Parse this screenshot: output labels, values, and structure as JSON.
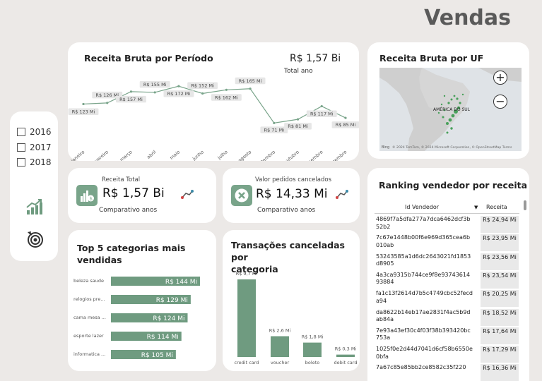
{
  "page_title": "Vendas",
  "filters": {
    "years": [
      "2016",
      "2017",
      "2018"
    ]
  },
  "period_card": {
    "title": "Receita Bruta por Período",
    "total_value": "R$ 1,57 Bi",
    "total_label": "Total ano"
  },
  "uf_card": {
    "title": "Receita Bruta por UF",
    "map_label": "AMÉRICA DO SUL",
    "attribution": "© 2024 TomTom, © 2024 Microsoft Corporation, © OpenStreetMap  Terms",
    "zoom_in": "+",
    "zoom_out": "−",
    "bing_label": "Bing"
  },
  "kpi_revenue": {
    "label": "Receita Total",
    "value": "R$ 1,57 Bi",
    "sub": "Comparativo anos"
  },
  "kpi_cancel": {
    "label": "Valor pedidos cancelados",
    "value": "R$ 14,33 Mi",
    "sub": "Comparativo anos"
  },
  "top5_card": {
    "title_line1": "Top 5 categorias mais",
    "title_line2": "vendidas"
  },
  "cancel_card": {
    "title_line1": "Transações canceladas por",
    "title_line2": "categoria"
  },
  "ranking_card": {
    "title": "Ranking vendedor por receita",
    "col_id": "Id Vendedor",
    "col_revenue": "Receita",
    "rows": [
      {
        "id": "4869f7a5dfa277a7dca6462dcf3b52b2",
        "revenue": "R$ 24,94 Mi"
      },
      {
        "id": "7c67e1448b00f6e969d365cea6b010ab",
        "revenue": "R$ 23,95 Mi"
      },
      {
        "id": "53243585a1d6dc2643021fd1853d8905",
        "revenue": "R$ 23,56 Mi"
      },
      {
        "id": "4a3ca9315b744ce9f8e9374361493884",
        "revenue": "R$ 23,54 Mi"
      },
      {
        "id": "fa1c13f2614d7b5c4749cbc52fecda94",
        "revenue": "R$ 20,25 Mi"
      },
      {
        "id": "da8622b14eb17ae2831f4ac5b9dab84a",
        "revenue": "R$ 18,52 Mi"
      },
      {
        "id": "7e93a43ef30c4f03f38b393420bc753a",
        "revenue": "R$ 17,64 Mi"
      },
      {
        "id": "1025f0e2d44d7041d6cf58b6550e0bfa",
        "revenue": "R$ 17,29 Mi"
      },
      {
        "id": "7a67c85e85bb2ce8582c35f220",
        "revenue": "R$ 16,36 Mi"
      }
    ]
  },
  "chart_data": [
    {
      "type": "line",
      "title": "Receita Bruta por Período",
      "categories": [
        "janeiro",
        "fevereiro",
        "março",
        "abril",
        "maio",
        "junho",
        "julho",
        "agosto",
        "setembro",
        "outubro",
        "novembro",
        "dezembro"
      ],
      "values": [
        123,
        126,
        157,
        155,
        172,
        152,
        162,
        165,
        71,
        81,
        117,
        85
      ],
      "data_labels": [
        "R$ 123 Mi",
        "R$ 126 Mi",
        "R$ 157 Mi",
        "R$ 155 Mi",
        "R$ 172 Mi",
        "R$ 152 Mi",
        "R$ 162 Mi",
        "R$ 165 Mi",
        "R$ 71 Mi",
        "R$ 81 Mi",
        "R$ 117 Mi",
        "R$ 85 Mi"
      ],
      "color": "#79a48a"
    },
    {
      "type": "bar",
      "orientation": "horizontal",
      "title": "Top 5 categorias mais vendidas",
      "categories": [
        "beleza saude",
        "relogios pre...",
        "cama mesa ...",
        "esporte lazer",
        "informatica ..."
      ],
      "values": [
        144,
        129,
        124,
        114,
        105
      ],
      "data_labels": [
        "R$ 144 Mi",
        "R$ 129 Mi",
        "R$ 124 Mi",
        "R$ 114 Mi",
        "R$ 105 Mi"
      ],
      "color": "#6f9b80"
    },
    {
      "type": "bar",
      "title": "Transações canceladas por categoria",
      "categories": [
        "credit card",
        "voucher",
        "boleto",
        "debit card"
      ],
      "values": [
        9.7,
        2.6,
        1.8,
        0.3
      ],
      "data_labels": [
        "R$ 9,7 Mi",
        "R$ 2,6 Mi",
        "R$ 1,8 Mi",
        "R$ 0,3 Mi"
      ],
      "color": "#6f9b80"
    }
  ]
}
